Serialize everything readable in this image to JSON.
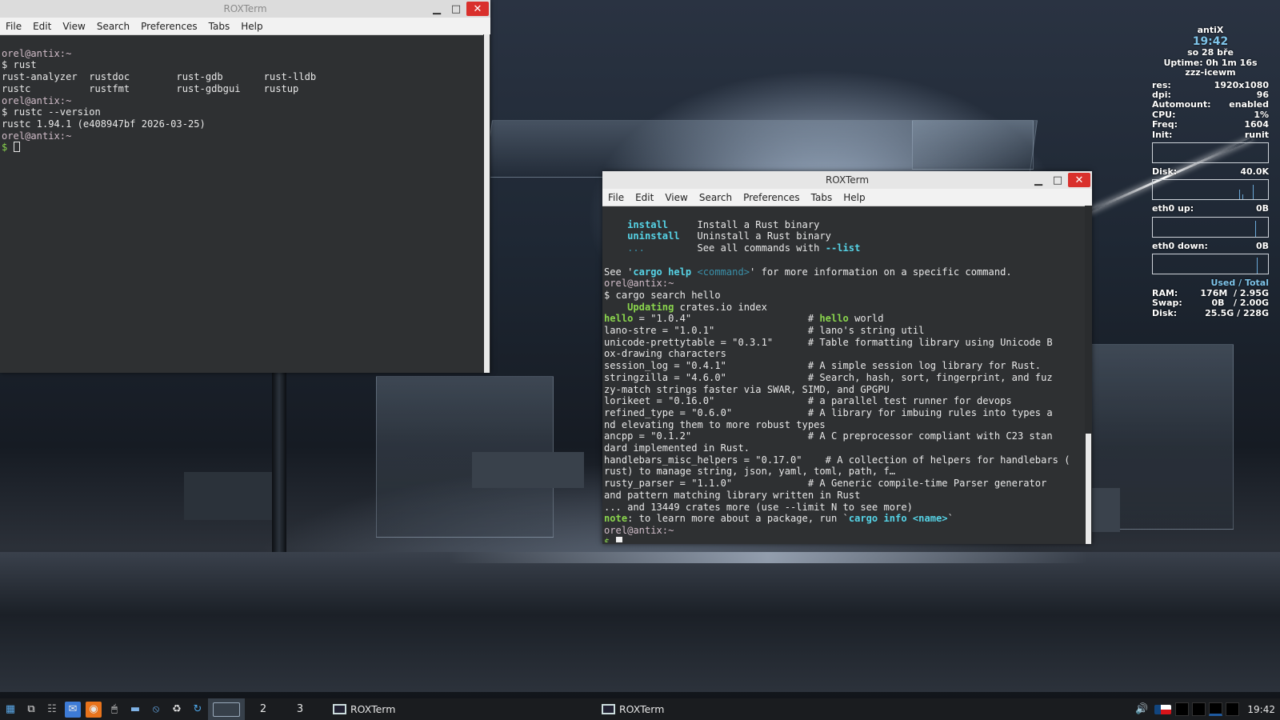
{
  "window1": {
    "title": "ROXTerm",
    "menu": [
      "File",
      "Edit",
      "View",
      "Search",
      "Preferences",
      "Tabs",
      "Help"
    ],
    "lines": [
      "orel@antix:~",
      "$ rust",
      "rust-analyzer  rustdoc        rust-gdb       rust-lldb",
      "rustc          rustfmt        rust-gdbgui    rustup",
      "orel@antix:~",
      "$ rustc --version",
      "rustc 1.94.1 (e408947bf 2026-03-25)",
      "orel@antix:~",
      "$ "
    ]
  },
  "window2": {
    "title": "ROXTerm",
    "menu": [
      "File",
      "Edit",
      "View",
      "Search",
      "Preferences",
      "Tabs",
      "Help"
    ],
    "cmd_install": "install",
    "desc_install": "Install a Rust binary",
    "cmd_uninstall": "uninstall",
    "desc_uninstall": "Uninstall a Rust binary",
    "cmd_dots": "...",
    "desc_dots": "See all commands with ",
    "list_flag": "--list",
    "see_pre": "See '",
    "see_cmd": "cargo help ",
    "see_arg": "<command>",
    "see_post": "' for more information on a specific command.",
    "prompt": "orel@antix:~",
    "search_cmd": "$ cargo search hello",
    "updating": "Updating",
    "updating_rest": " crates.io index",
    "hello_name": "hello",
    "hello_rest": " = \"1.0.4\"                    # ",
    "hello_word": "hello",
    "hello_desc": " world",
    "results": [
      "lano-stre = \"1.0.1\"                # lano's string util",
      "unicode-prettytable = \"0.3.1\"      # Table formatting library using Unicode B",
      "ox-drawing characters",
      "session_log = \"0.4.1\"              # A simple session log library for Rust.",
      "stringzilla = \"4.6.0\"              # Search, hash, sort, fingerprint, and fuz",
      "zy-match strings faster via SWAR, SIMD, and GPGPU",
      "lorikeet = \"0.16.0\"                # a parallel test runner for devops",
      "refined_type = \"0.6.0\"             # A library for imbuing rules into types a",
      "nd elevating them to more robust types",
      "ancpp = \"0.1.2\"                    # A C preprocessor compliant with C23 stan",
      "dard implemented in Rust.",
      "handlebars_misc_helpers = \"0.17.0\"    # A collection of helpers for handlebars (",
      "rust) to manage string, json, yaml, toml, path, f…",
      "rusty_parser = \"1.1.0\"             # A Generic compile-time Parser generator",
      "and pattern matching library written in Rust",
      "... and 13449 crates more (use --limit N to see more)"
    ],
    "note_label": "note",
    "note_text": ": to learn more about a package, run `",
    "note_cmd": "cargo info <name>",
    "note_end": "`",
    "final_prompt": "orel@antix:~",
    "dollar": "$ "
  },
  "conky": {
    "host": "antiX",
    "time": "19:42",
    "date": "so 28 bře",
    "uptime": "Uptime: 0h 1m 16s",
    "wm": "zzz-icewm",
    "stats": [
      {
        "label": "res:",
        "value": "1920x1080"
      },
      {
        "label": "dpi:",
        "value": "96"
      },
      {
        "label": "Automount:",
        "value": "enabled"
      },
      {
        "label": "CPU:",
        "value": "1%"
      },
      {
        "label": "Freq:",
        "value": "1604"
      },
      {
        "label": "Init:",
        "value": "runit"
      }
    ],
    "disk_label": "Disk:",
    "disk_value": "40.0K",
    "eth_up_label": "eth0 up:",
    "eth_up_value": "0B",
    "eth_down_label": "eth0 down:",
    "eth_down_value": "0B",
    "used_total": "Used / Total",
    "mem": [
      {
        "label": "RAM:",
        "value": "176M  / 2.95G"
      },
      {
        "label": "Swap:",
        "value": "0B   / 2.00G"
      },
      {
        "label": "Disk:",
        "value": "25.5G / 228G"
      }
    ]
  },
  "taskbar": {
    "workspaces": [
      "2",
      "3"
    ],
    "task1": "ROXTerm",
    "task2": "ROXTerm",
    "clock": "19:42"
  }
}
